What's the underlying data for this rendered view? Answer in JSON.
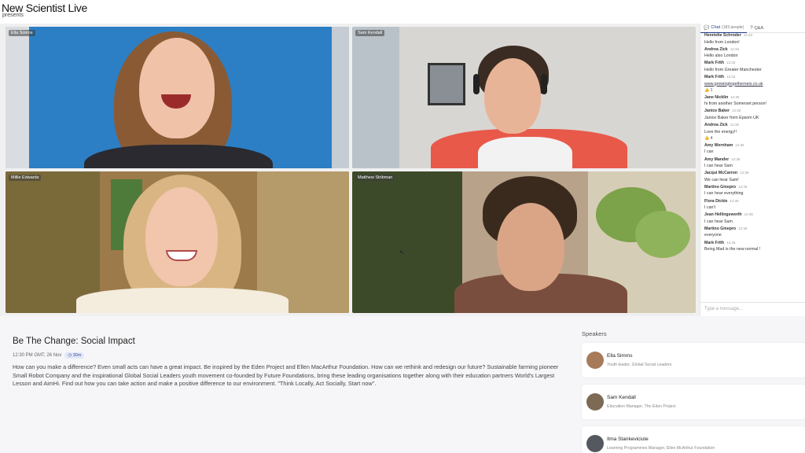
{
  "header": {
    "brand": "New Scientist Live",
    "presents": "presents"
  },
  "video": {
    "tiles": [
      {
        "name": "Ella Simms"
      },
      {
        "name": "Sam Kendall"
      },
      {
        "name": "Millie Edwards"
      },
      {
        "name": "Matthew Stribman"
      }
    ]
  },
  "chat": {
    "tab_chat": "Chat",
    "tab_chat_count": "(183 people)",
    "tab_qa": "Q&A",
    "input_placeholder": "Type a message...",
    "messages": [
      {
        "who": "Henriette Schroder",
        "time": "12:33",
        "text": "Hello from London!"
      },
      {
        "who": "Andrea Zick",
        "time": "12:33",
        "text": "Hello also London"
      },
      {
        "who": "Mark Frith",
        "time": "12:33",
        "text": "Hello from Greater Manchester"
      },
      {
        "who": "Mark Frith",
        "time": "12:34",
        "text": "www.growingtogetherneis.co.uk",
        "react": "👍 1"
      },
      {
        "who": "Jane Nicklin",
        "time": "12:35",
        "text": "hi from another Somerset person!"
      },
      {
        "who": "Janice Baker",
        "time": "12:36",
        "text": "Janice Baker from Epsom UK"
      },
      {
        "who": "Andrea Zick",
        "time": "12:36",
        "text": "Love the energy!!",
        "react": "👍 4"
      },
      {
        "who": "Amy Wernham",
        "time": "12:36",
        "text": "I can"
      },
      {
        "who": "Amy Mander",
        "time": "12:36",
        "text": "I can hear Sam"
      },
      {
        "who": "Jacqui McCarron",
        "time": "12:36",
        "text": "We can hear Sam!"
      },
      {
        "who": "Martino Ginepro",
        "time": "12:36",
        "text": "I can hear everything"
      },
      {
        "who": "Flora Dickie",
        "time": "12:36",
        "text": "I can't"
      },
      {
        "who": "Jean Hellingsworth",
        "time": "12:36",
        "text": "I can hear Sam"
      },
      {
        "who": "Martino Ginepro",
        "time": "12:36",
        "text": "everyone"
      },
      {
        "who": "Mark Frith",
        "time": "12:36",
        "text": "Being Mad is the new normal !"
      }
    ]
  },
  "event": {
    "title": "Be The Change: Social Impact",
    "datetime": "12:30 PM GMT, 26 Nov",
    "duration": "30m",
    "description": "How can you make a difference? Even small acts can have a great impact. Be inspired by the Eden Project and Ellen MacArthur Foundation. How can we rethink and redesign our future? Sustainable farming pioneer Small Robot Company and the inspirational Global Social Leaders youth movement co-founded by Future Foundations, bring these leading organisations together along with their education partners World's Largest Lesson and AimHi. Find out how you can take action and make a positive difference to our environment. \"Think Locally, Act Socially, Start now\"."
  },
  "speakers": {
    "title": "Speakers",
    "list": [
      {
        "name": "Ella Simms",
        "role": "Youth leader, Global Social Leaders",
        "color": "#a77a5a"
      },
      {
        "name": "Sam Kendall",
        "role": "Education Manager, The Eden Project",
        "color": "#7d6a55"
      },
      {
        "name": "Ilma Stankeviciute",
        "role": "Learning Programmes Manager, Ellen McArthur Foundation",
        "color": "#55585e"
      }
    ]
  }
}
